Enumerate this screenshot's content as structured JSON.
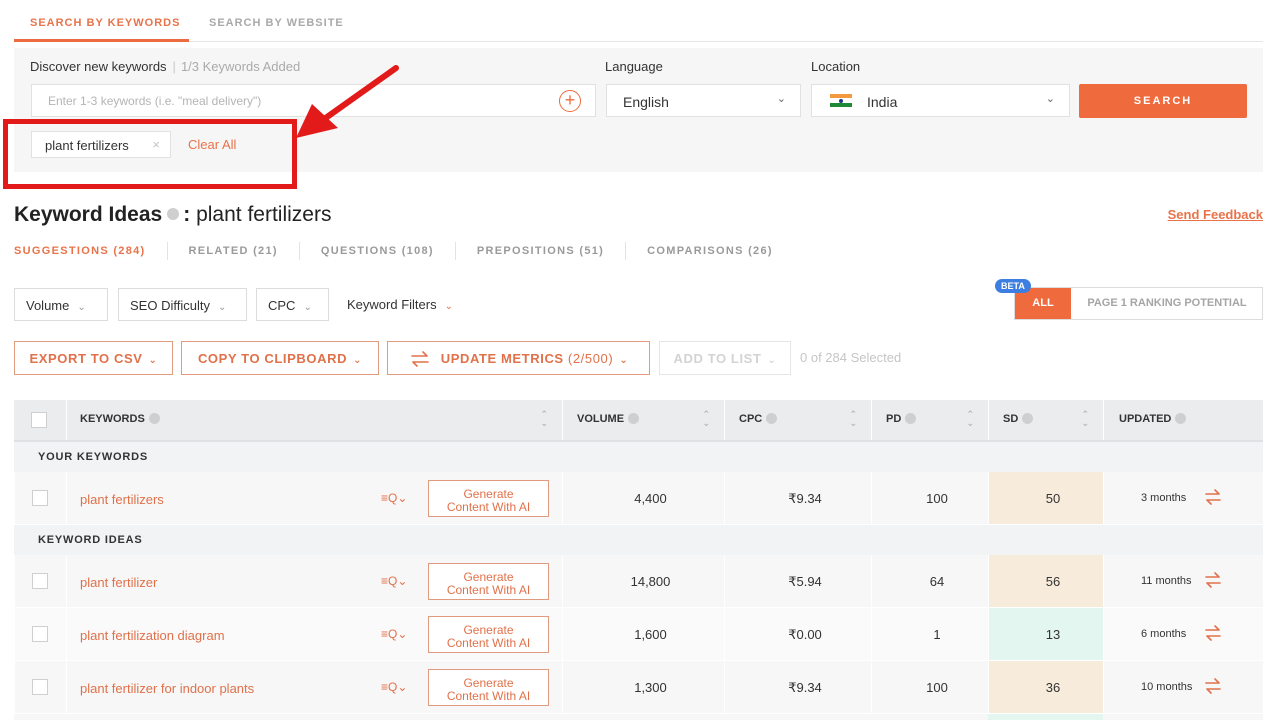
{
  "top_tabs": [
    {
      "label": "SEARCH BY KEYWORDS",
      "active": true
    },
    {
      "label": "SEARCH BY WEBSITE",
      "active": false
    }
  ],
  "search": {
    "discover_label": "Discover new keywords",
    "added_status": "1/3 Keywords Added",
    "placeholder": "Enter 1-3 keywords (i.e. \"meal delivery\")",
    "language_label": "Language",
    "language_value": "English",
    "location_label": "Location",
    "location_value": "India",
    "search_button": "SEARCH",
    "chips": [
      {
        "label": "plant fertilizers",
        "remove": "×"
      }
    ],
    "clear_all": "Clear All"
  },
  "annotation": {
    "color": "#e21a1a"
  },
  "keyword_ideas": {
    "title": "Keyword Ideas",
    "separator": ":",
    "term": "plant fertilizers",
    "send_feedback": "Send Feedback",
    "tabs": [
      {
        "label": "SUGGESTIONS (284)",
        "active": true
      },
      {
        "label": "RELATED (21)",
        "active": false
      },
      {
        "label": "QUESTIONS (108)",
        "active": false
      },
      {
        "label": "PREPOSITIONS (51)",
        "active": false
      },
      {
        "label": "COMPARISONS (26)",
        "active": false
      }
    ]
  },
  "filters": {
    "items": [
      "Volume",
      "SEO Difficulty",
      "CPC",
      "Keyword Filters"
    ],
    "beta_badge": "BETA",
    "segment_all": "ALL",
    "segment_page1": "PAGE 1 RANKING POTENTIAL"
  },
  "actions": {
    "export_csv": "EXPORT TO CSV",
    "copy_clipboard": "COPY TO CLIPBOARD",
    "update_metrics": "UPDATE METRICS",
    "update_count": "(2/500)",
    "add_to_list": "ADD TO LIST",
    "selected_count": "0 of 284 Selected"
  },
  "table": {
    "headers": {
      "keywords": "KEYWORDS",
      "volume": "VOLUME",
      "cpc": "CPC",
      "pd": "PD",
      "sd": "SD",
      "updated": "UPDATED"
    },
    "generate_label_line1": "Generate",
    "generate_label_line2": "Content With AI",
    "groups": [
      {
        "title": "YOUR KEYWORDS",
        "rows": [
          {
            "keyword": "plant fertilizers",
            "volume": "4,400",
            "cpc": "₹9.34",
            "pd": "100",
            "sd": "50",
            "sd_level": "medium",
            "updated": "3 months"
          }
        ]
      },
      {
        "title": "KEYWORD IDEAS",
        "rows": [
          {
            "keyword": "plant fertilizer",
            "volume": "14,800",
            "cpc": "₹5.94",
            "pd": "64",
            "sd": "56",
            "sd_level": "medium",
            "updated": "11 months"
          },
          {
            "keyword": "plant fertilization diagram",
            "volume": "1,600",
            "cpc": "₹0.00",
            "pd": "1",
            "sd": "13",
            "sd_level": "low",
            "updated": "6 months"
          },
          {
            "keyword": "plant fertilizer for indoor plants",
            "volume": "1,300",
            "cpc": "₹9.34",
            "pd": "100",
            "sd": "36",
            "sd_level": "medium",
            "updated": "10 months"
          }
        ]
      }
    ]
  },
  "colors": {
    "accent": "#ef6a3c",
    "link": "#e0714a",
    "sd_medium": "#f7ecdb",
    "sd_low": "#e3f6ef",
    "beta": "#3d7fe0"
  }
}
